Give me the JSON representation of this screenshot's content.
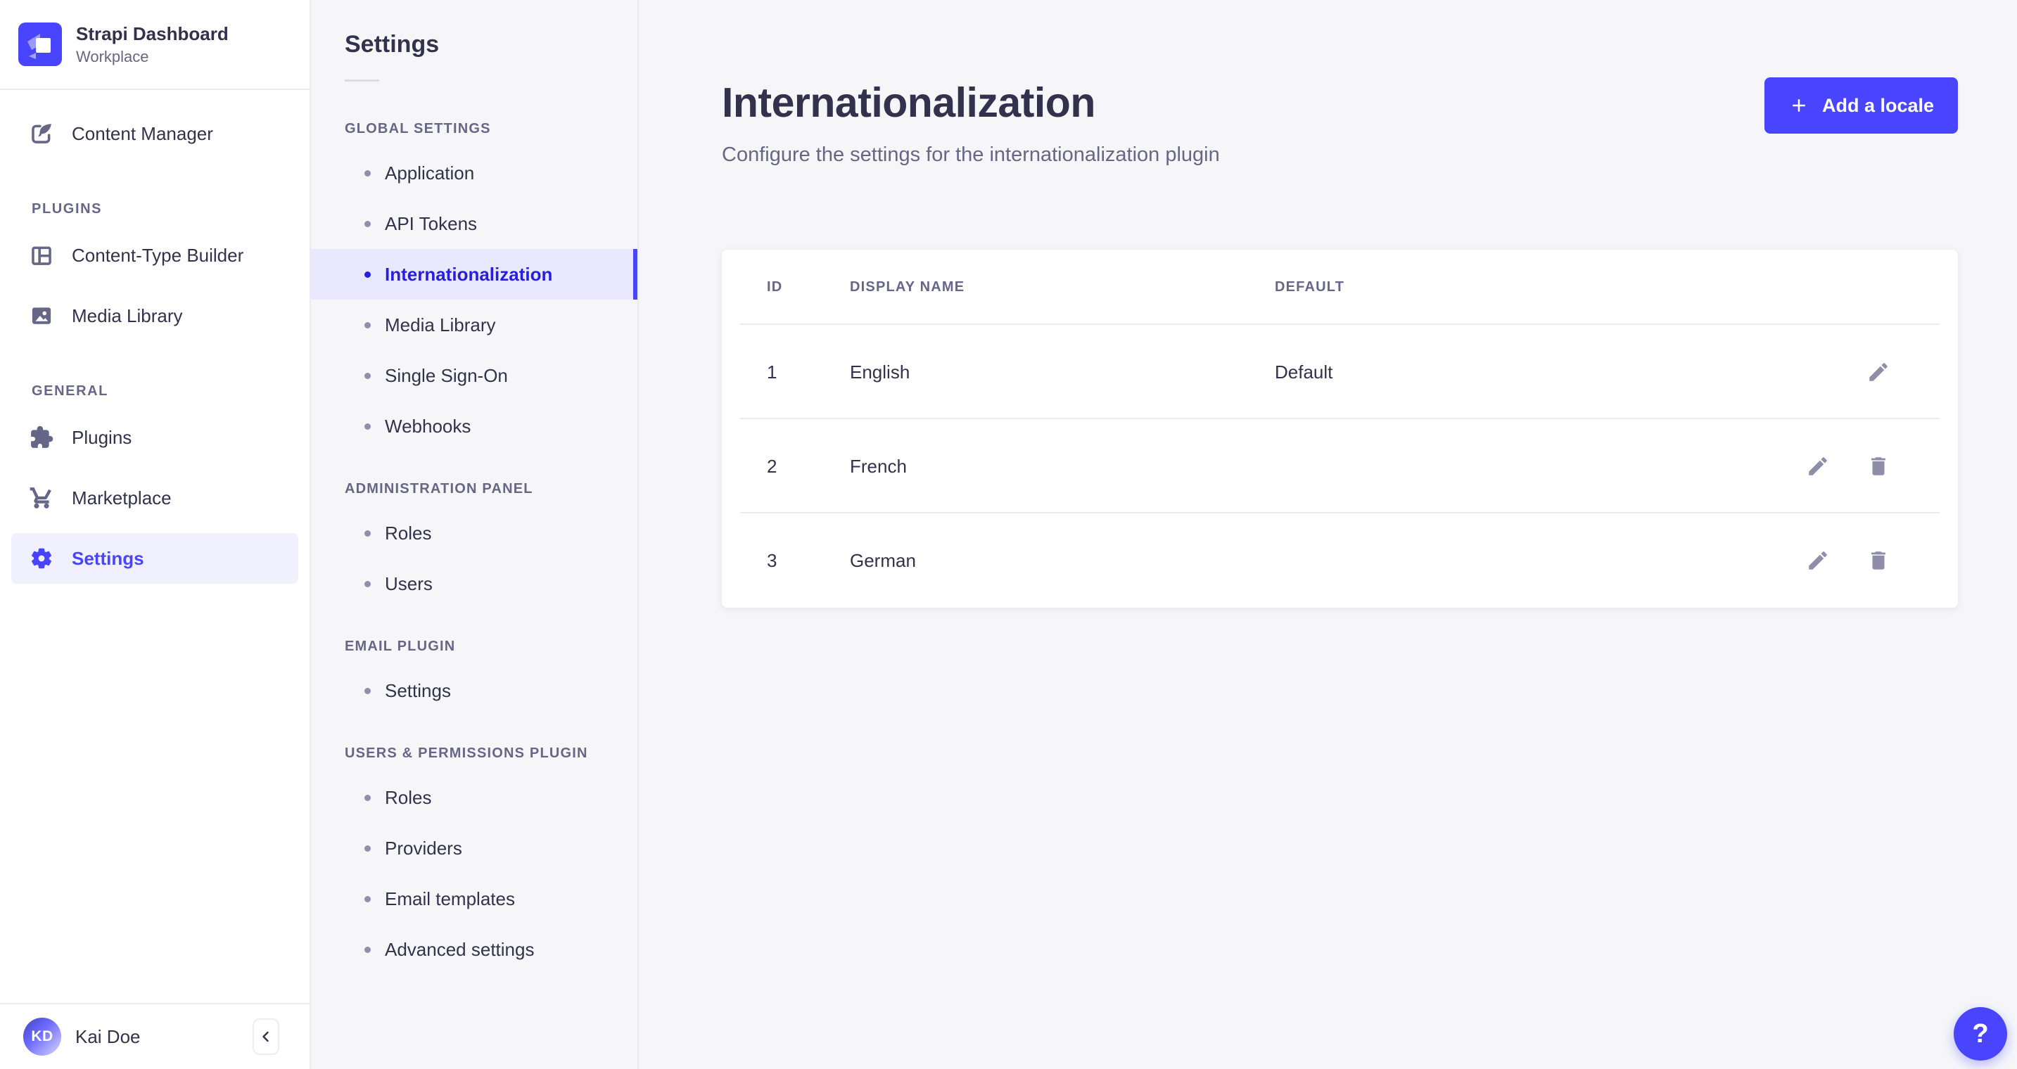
{
  "brand": {
    "title": "Strapi Dashboard",
    "subtitle": "Workplace",
    "logo_icon": "strapi-logo"
  },
  "sidebar": {
    "top_item": {
      "label": "Content Manager",
      "icon": "pen-feather-icon"
    },
    "sections": [
      {
        "label": "PLUGINS",
        "items": [
          {
            "label": "Content-Type Builder",
            "icon": "layout-icon"
          },
          {
            "label": "Media Library",
            "icon": "image-icon"
          }
        ]
      },
      {
        "label": "GENERAL",
        "items": [
          {
            "label": "Plugins",
            "icon": "puzzle-icon"
          },
          {
            "label": "Marketplace",
            "icon": "cart-icon"
          },
          {
            "label": "Settings",
            "icon": "gear-icon",
            "active": true
          }
        ]
      }
    ],
    "footer": {
      "avatar_initials": "KD",
      "user_name": "Kai Doe",
      "collapse_icon": "chevron-left-icon"
    }
  },
  "subnav": {
    "title": "Settings",
    "sections": [
      {
        "label": "GLOBAL SETTINGS",
        "items": [
          "Application",
          "API Tokens",
          "Internationalization",
          "Media Library",
          "Single Sign-On",
          "Webhooks"
        ],
        "active_item": "Internationalization"
      },
      {
        "label": "ADMINISTRATION PANEL",
        "items": [
          "Roles",
          "Users"
        ]
      },
      {
        "label": "EMAIL PLUGIN",
        "items": [
          "Settings"
        ]
      },
      {
        "label": "USERS & PERMISSIONS PLUGIN",
        "items": [
          "Roles",
          "Providers",
          "Email templates",
          "Advanced settings"
        ]
      }
    ]
  },
  "main": {
    "title": "Internationalization",
    "subtitle": "Configure the settings for the internationalization plugin",
    "add_button": {
      "label": "Add a locale",
      "icon": "plus-icon"
    },
    "table": {
      "columns": [
        "ID",
        "DISPLAY NAME",
        "DEFAULT"
      ],
      "rows": [
        {
          "id": "1",
          "display_name": "English",
          "default": "Default",
          "actions": [
            "edit"
          ]
        },
        {
          "id": "2",
          "display_name": "French",
          "default": "",
          "actions": [
            "edit",
            "delete"
          ]
        },
        {
          "id": "3",
          "display_name": "German",
          "default": "",
          "actions": [
            "edit",
            "delete"
          ]
        }
      ]
    }
  },
  "help": {
    "label": "?"
  },
  "colors": {
    "primary": "#4945ff",
    "active_link_text": "#271fe0",
    "sidebar_active_bg": "#f0f0ff",
    "subnav_active_bg": "#e9e8ff",
    "text_dark": "#32324d",
    "text_muted": "#666687",
    "icon_muted": "#8e8ea9",
    "border": "#eaeaef",
    "app_bg": "#f6f6f9"
  }
}
